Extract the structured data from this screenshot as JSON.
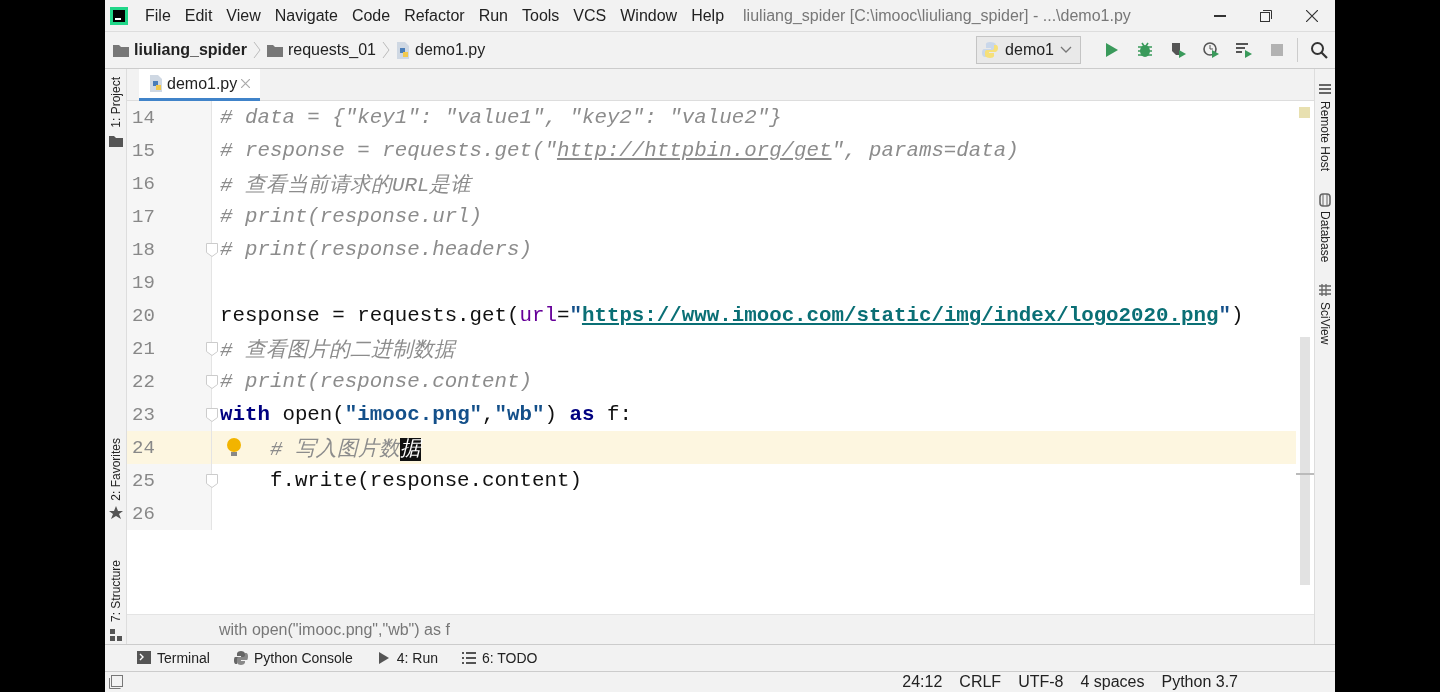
{
  "window": {
    "title": "liuliang_spider [C:\\imooc\\liuliang_spider] - ...\\demo1.py"
  },
  "menu": [
    "File",
    "Edit",
    "View",
    "Navigate",
    "Code",
    "Refactor",
    "Run",
    "Tools",
    "VCS",
    "Window",
    "Help"
  ],
  "navigation_bar": {
    "path": [
      {
        "label": "liuliang_spider",
        "kind": "project"
      },
      {
        "label": "requests_01",
        "kind": "folder"
      },
      {
        "label": "demo1.py",
        "kind": "file"
      }
    ],
    "run_configuration": "demo1",
    "actions": [
      {
        "kind": "run",
        "disabled": false
      },
      {
        "kind": "debug",
        "disabled": false
      },
      {
        "kind": "coverage",
        "disabled": false
      },
      {
        "kind": "profile",
        "disabled": false
      },
      {
        "kind": "concurrency",
        "disabled": false
      },
      {
        "kind": "stop",
        "disabled": true
      },
      {
        "kind": "search",
        "disabled": false
      }
    ]
  },
  "left_tool_strip": [
    {
      "label": "1: Project",
      "kind": "folder"
    },
    {
      "label": "2: Favorites",
      "kind": "star"
    },
    {
      "label": "7: Structure",
      "kind": "structure"
    }
  ],
  "right_tool_strip": [
    {
      "label": "Remote Host",
      "kind": "list"
    },
    {
      "label": "Database",
      "kind": "database"
    },
    {
      "label": "SciView",
      "kind": "grid"
    }
  ],
  "tabs": [
    {
      "label": "demo1.py",
      "selected": true
    }
  ],
  "editor": {
    "lines": [
      {
        "number": "14",
        "current": false,
        "fold": false,
        "bulb": false,
        "segments": [
          {
            "text": "# data = {\"key1\": \"value1\", \"key2\": \"value2\"}",
            "kind": "comment"
          }
        ]
      },
      {
        "number": "15",
        "current": false,
        "fold": false,
        "bulb": false,
        "segments": [
          {
            "text": "# response = requests.get(\"",
            "kind": "comment"
          },
          {
            "text": "http://httpbin.org/get",
            "kind": "comment-link"
          },
          {
            "text": "\", params=data)",
            "kind": "comment"
          }
        ]
      },
      {
        "number": "16",
        "current": false,
        "fold": false,
        "bulb": false,
        "segments": [
          {
            "text": "# 查看当前请求的URL是谁",
            "kind": "comment"
          }
        ]
      },
      {
        "number": "17",
        "current": false,
        "fold": false,
        "bulb": false,
        "segments": [
          {
            "text": "# print(response.url)",
            "kind": "comment"
          }
        ]
      },
      {
        "number": "18",
        "current": false,
        "fold": true,
        "bulb": false,
        "segments": [
          {
            "text": "# print(response.headers)",
            "kind": "comment"
          }
        ]
      },
      {
        "number": "19",
        "current": false,
        "fold": false,
        "bulb": false
      },
      {
        "number": "20",
        "current": false,
        "fold": false,
        "bulb": false,
        "segments": [
          {
            "text": "response = requests.get(",
            "kind": "plain"
          },
          {
            "text": "url",
            "kind": "param"
          },
          {
            "text": "=",
            "kind": "plain"
          },
          {
            "text": "\"",
            "kind": "string"
          },
          {
            "text": "https://www.imooc.com/static/img/index/logo2020.png",
            "kind": "link"
          },
          {
            "text": "\"",
            "kind": "string"
          },
          {
            "text": ")",
            "kind": "plain"
          }
        ]
      },
      {
        "number": "21",
        "current": false,
        "fold": true,
        "bulb": false,
        "segments": [
          {
            "text": "# 查看图片的二进制数据",
            "kind": "comment"
          }
        ]
      },
      {
        "number": "22",
        "current": false,
        "fold": true,
        "bulb": false,
        "segments": [
          {
            "text": "# print(response.content)",
            "kind": "comment"
          }
        ]
      },
      {
        "number": "23",
        "current": false,
        "fold": true,
        "bulb": false,
        "segments": [
          {
            "text": "with",
            "kind": "keyword"
          },
          {
            "text": " open(",
            "kind": "plain"
          },
          {
            "text": "\"imooc.png\"",
            "kind": "string"
          },
          {
            "text": ",",
            "kind": "plain"
          },
          {
            "text": "\"wb\"",
            "kind": "string"
          },
          {
            "text": ") ",
            "kind": "plain"
          },
          {
            "text": "as",
            "kind": "keyword"
          },
          {
            "text": " f:",
            "kind": "plain"
          }
        ]
      },
      {
        "number": "24",
        "current": true,
        "fold": false,
        "bulb": true,
        "segments": [
          {
            "text": "    # 写入图片数",
            "kind": "comment"
          },
          {
            "text": "据",
            "kind": "selection"
          }
        ]
      },
      {
        "number": "25",
        "current": false,
        "fold": true,
        "bulb": false,
        "segments": [
          {
            "text": "    f.write(response.content)",
            "kind": "plain"
          }
        ]
      },
      {
        "number": "26",
        "current": false,
        "fold": false,
        "bulb": false
      }
    ]
  },
  "breadcrumb": "with open(\"imooc.png\",\"wb\") as f",
  "tool_windows": [
    {
      "label": "Terminal",
      "kind": "terminal"
    },
    {
      "label": "Python Console",
      "kind": "python"
    },
    {
      "label": "4: Run",
      "kind": "run"
    },
    {
      "label": "6: TODO",
      "kind": "todo"
    }
  ],
  "status_bar": [
    "24:12",
    "CRLF",
    "UTF-8",
    "4 spaces",
    "Python 3.7"
  ]
}
